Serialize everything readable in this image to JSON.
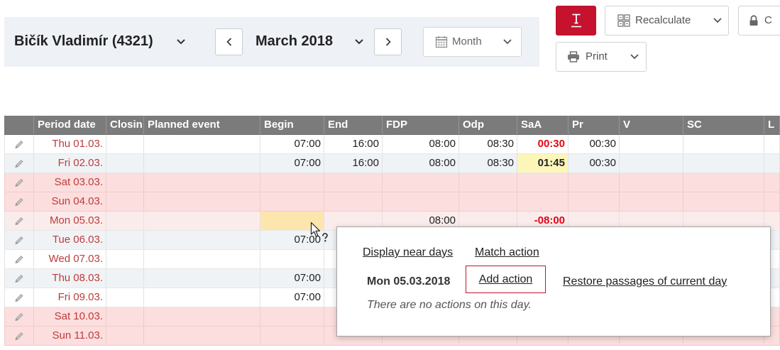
{
  "employee": {
    "name": "Bičík Vladimír (4321)"
  },
  "period": {
    "label": "March 2018"
  },
  "view": {
    "selected": "Month"
  },
  "toolbar": {
    "recalculate_label": "Recalculate",
    "print_label": "Print",
    "lock_label": "C"
  },
  "icons": {
    "employee_dropdown": "chevron-down-icon",
    "previous_period": "chevron-left-icon",
    "next_period": "chevron-right-icon",
    "view_mode": "calendar-icon",
    "primary_action": "text-format-icon",
    "recalculate": "table-grid-icon",
    "lock": "lock-icon",
    "print": "printer-icon",
    "row_edit": "pencil-icon",
    "pointer": "help-cursor-icon"
  },
  "colors": {
    "accent": "#c4122f",
    "header_bg": "#7b7b7b",
    "weekend": "#fcdede",
    "selected_row": "#fbecec",
    "alt_row": "#f0f3f6",
    "date": "#bd3c3c",
    "negative": "#e30613",
    "highlight": "#fdf6b9",
    "begin_highlight": "#fde6ad",
    "panel": "#eef1f5"
  },
  "table": {
    "columns": [
      "",
      "Period date",
      "Closin",
      "Planned event",
      "Begin",
      "End",
      "FDP",
      "Odp",
      "SaA",
      "Pr",
      "V",
      "SC",
      "L"
    ],
    "rows": [
      {
        "date": "Thu 01.03.",
        "begin": "07:00",
        "end": "16:00",
        "fdp": "08:00",
        "odp": "08:30",
        "saa": "00:30",
        "saa_style": "negative",
        "pr": "00:30"
      },
      {
        "date": "Fri 02.03.",
        "begin": "07:00",
        "end": "16:00",
        "fdp": "08:00",
        "odp": "08:30",
        "saa": "01:45",
        "saa_style": "highlight",
        "pr": "00:30"
      },
      {
        "date": "Sat 03.03.",
        "weekend": true
      },
      {
        "date": "Sun 04.03.",
        "weekend": true
      },
      {
        "date": "Mon 05.03.",
        "selected": true,
        "begin_highlight": true,
        "fdp": "08:00",
        "saa": "-08:00",
        "saa_style": "negative"
      },
      {
        "date": "Tue 06.03.",
        "begin": "07:00"
      },
      {
        "date": "Wed 07.03."
      },
      {
        "date": "Thu 08.03.",
        "begin": "07:00"
      },
      {
        "date": "Fri 09.03.",
        "begin": "07:00"
      },
      {
        "date": "Sat 10.03.",
        "weekend": true
      },
      {
        "date": "Sun 11.03.",
        "weekend": true
      }
    ]
  },
  "day_popup": {
    "display_near_days": "Display near days",
    "match_action": "Match action",
    "date": "Mon 05.03.2018",
    "add_action": "Add action",
    "restore_passages": "Restore passages of current day",
    "empty_message": "There are no actions on this day."
  }
}
